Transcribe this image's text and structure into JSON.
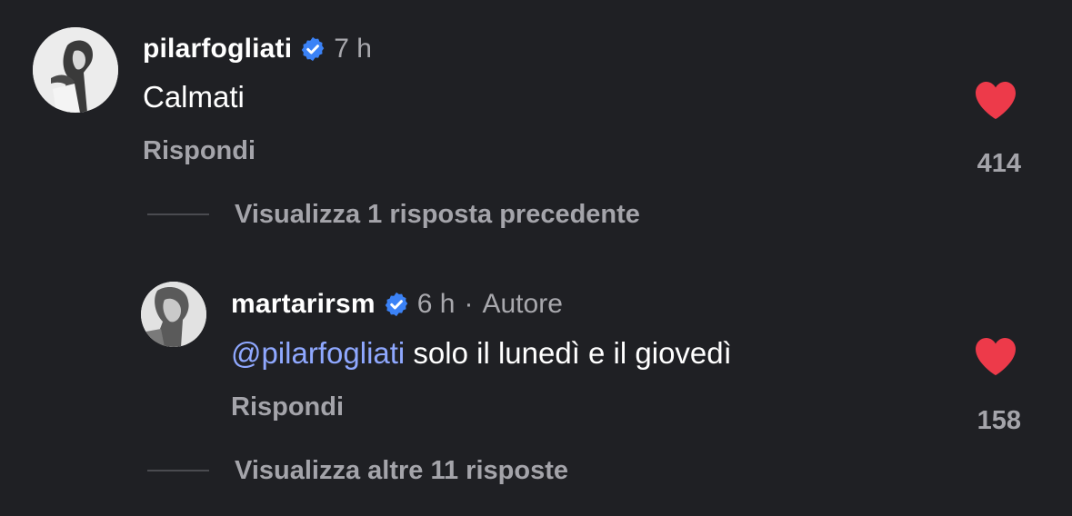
{
  "comments": [
    {
      "username": "pilarfogliati",
      "verified_icon": "verified-badge-icon",
      "time": "7 h",
      "text": "Calmati",
      "reply_label": "Rispondi",
      "likes": "414",
      "liked": true
    },
    {
      "username": "martarirsm",
      "verified_icon": "verified-badge-icon",
      "time": "6 h",
      "separator": "·",
      "author_badge": "Autore",
      "mention": "@pilarfogliati",
      "text": "solo il lunedì e il giovedì",
      "reply_label": "Rispondi",
      "likes": "158",
      "liked": true
    }
  ],
  "view_previous": "Visualizza 1 risposta precedente",
  "view_more": "Visualizza altre 11 risposte",
  "colors": {
    "background": "#1f2024",
    "verified": "#3b82f6",
    "heart": "#ed3a4a",
    "mention": "#8fa8ff",
    "muted": "#a4a4aa"
  }
}
